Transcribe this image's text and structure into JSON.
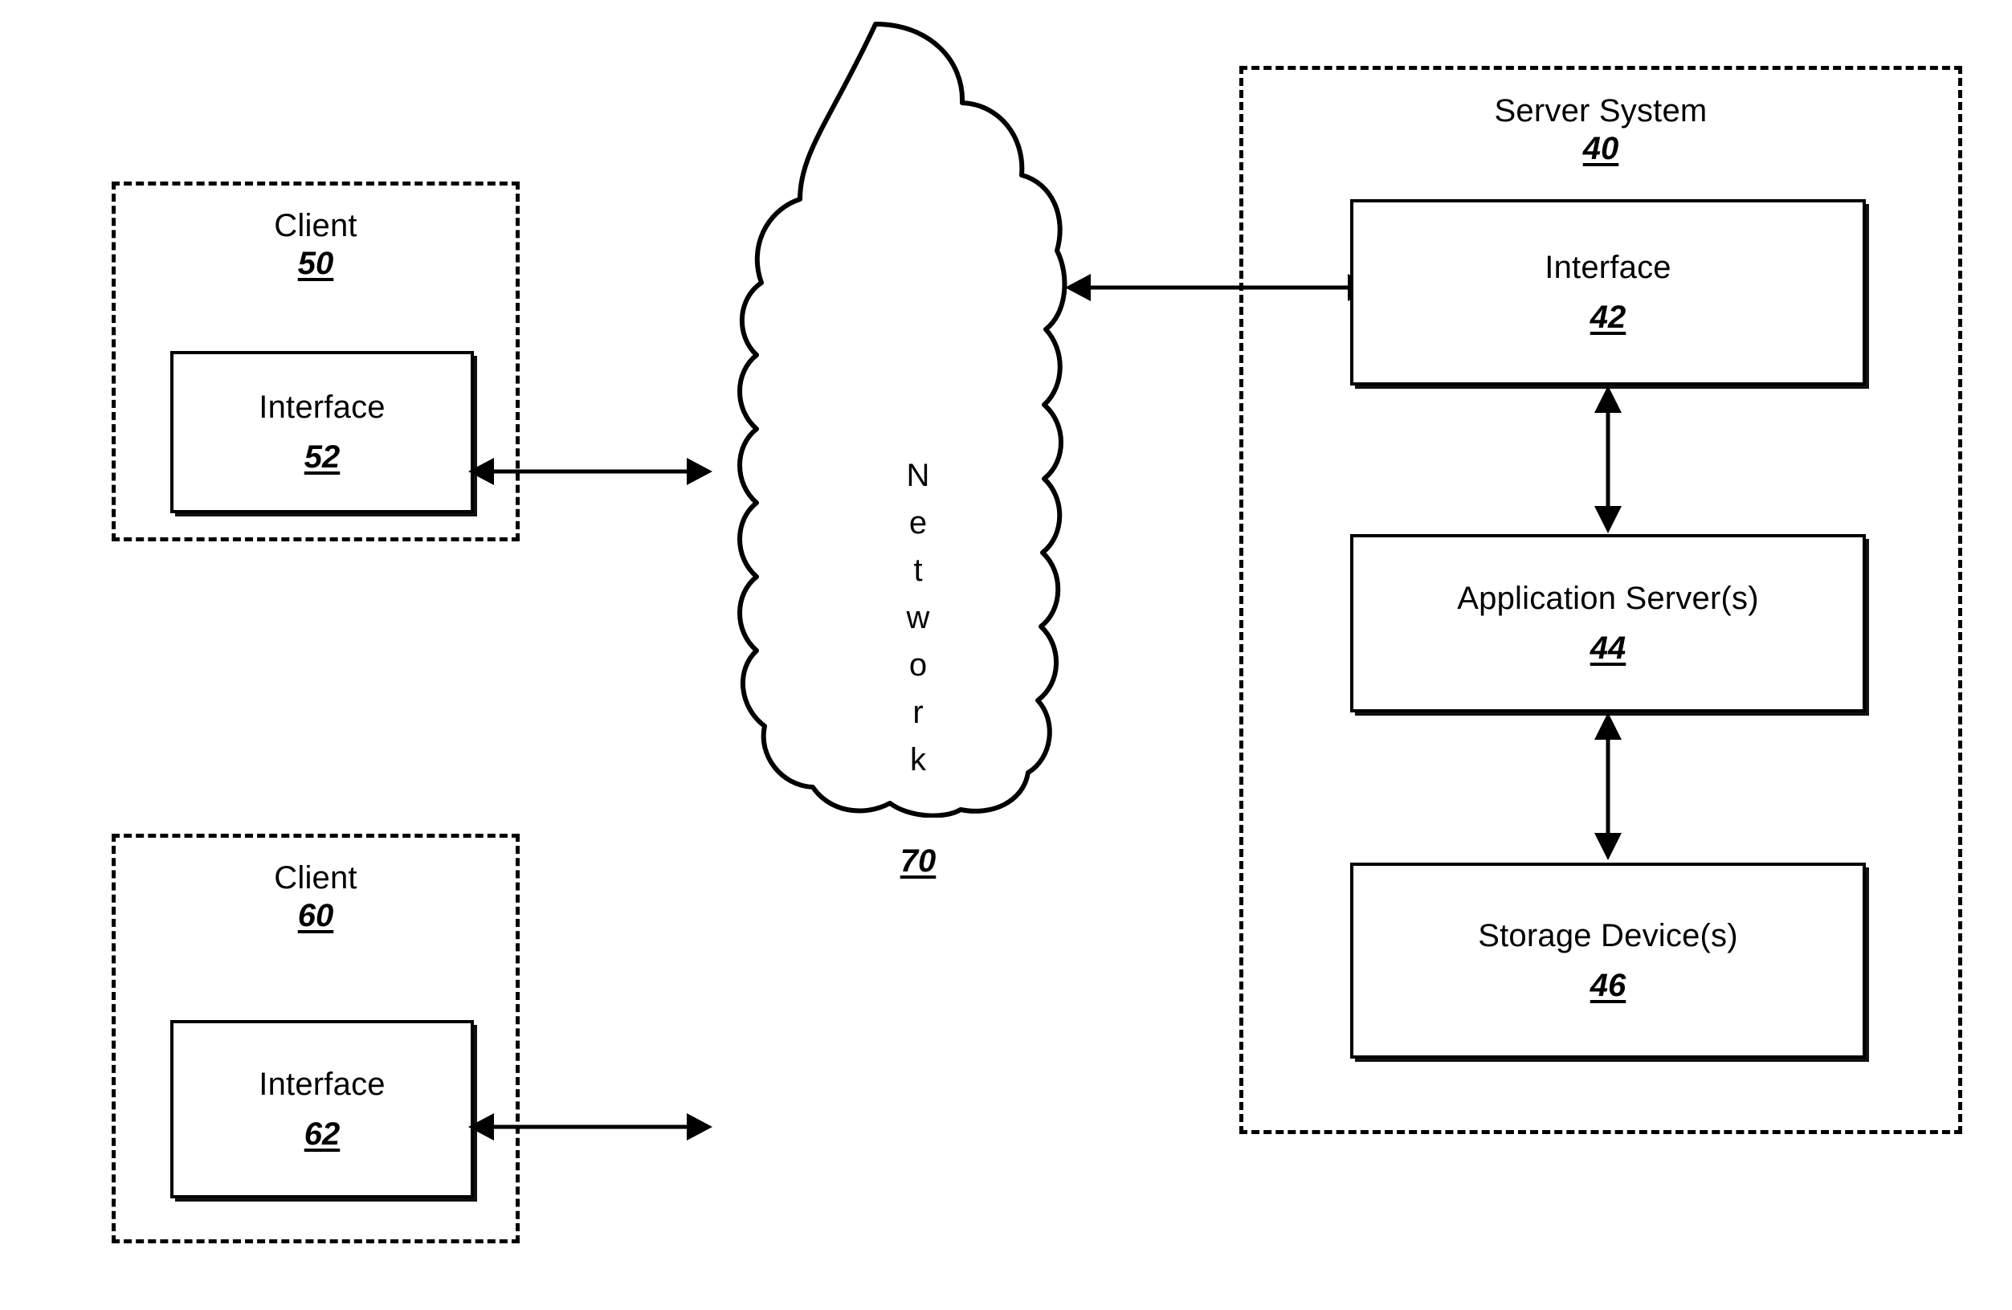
{
  "figure": {
    "type": "network-architecture-diagram",
    "background_color": "#ffffff",
    "line_color": "#000000"
  },
  "clients": [
    {
      "group_label": "Client",
      "group_ref": "50",
      "inner_label": "Interface",
      "inner_ref": "52"
    },
    {
      "group_label": "Client",
      "group_ref": "60",
      "inner_label": "Interface",
      "inner_ref": "62"
    }
  ],
  "network": {
    "label_letters": [
      "N",
      "e",
      "t",
      "w",
      "o",
      "r",
      "k"
    ],
    "label": "Network",
    "ref": "70"
  },
  "server_system": {
    "group_label": "Server System",
    "group_ref": "40",
    "components": [
      {
        "label": "Interface",
        "ref": "42"
      },
      {
        "label": "Application Server(s)",
        "ref": "44"
      },
      {
        "label": "Storage Device(s)",
        "ref": "46"
      }
    ]
  },
  "connections": [
    {
      "name": "client-50-to-network",
      "direction": "bidirectional"
    },
    {
      "name": "client-60-to-network",
      "direction": "bidirectional"
    },
    {
      "name": "network-to-server-interface",
      "direction": "bidirectional"
    },
    {
      "name": "interface-42-to-application-server-44",
      "direction": "bidirectional"
    },
    {
      "name": "application-server-44-to-storage-device-46",
      "direction": "bidirectional"
    }
  ]
}
